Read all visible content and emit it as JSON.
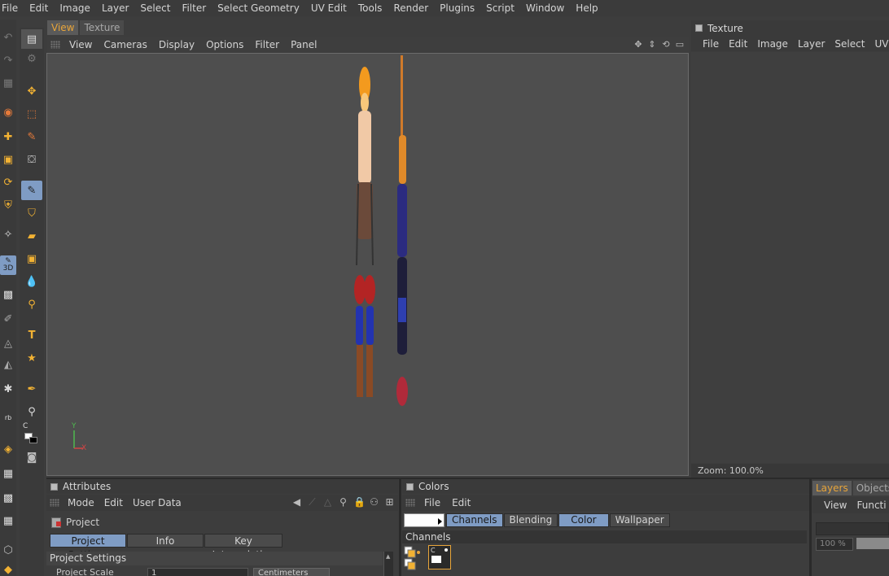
{
  "menubar": {
    "items": [
      "File",
      "Edit",
      "Image",
      "Layer",
      "Select",
      "Filter",
      "Select Geometry",
      "UV Edit",
      "Tools",
      "Render",
      "Plugins",
      "Script",
      "Window",
      "Help"
    ]
  },
  "tool_icons": {
    "outer": [
      "undo-icon",
      "redo-icon",
      "model-mode-icon",
      "texture-mode-icon",
      "move-icon",
      "scale-icon",
      "rotate-icon",
      "lock-axis-icon",
      "magic-brush-icon",
      "paint-3d-icon",
      "checker-icon",
      "brush-icon",
      "sketch-icon",
      "uv-icon",
      "cube-icon",
      "checkerboard-icon",
      "cube-small-icon",
      "checker-small-icon",
      "grid-icon",
      "box-icon"
    ],
    "inner_selected": "brush-tool",
    "paint_3d_badge": "3D",
    "rb_badge": "rb",
    "c_badge": "C"
  },
  "viewport": {
    "tabs": [
      "View",
      "Texture"
    ],
    "active_tab": "View",
    "menu": [
      "View",
      "Cameras",
      "Display",
      "Options",
      "Filter",
      "Panel"
    ],
    "axis_y": "Y",
    "axis_x": "X",
    "colors": {
      "background": "#4e4e4e",
      "axis_y": "#4fb84f",
      "axis_x": "#d24545"
    }
  },
  "texture_panel": {
    "title": "Texture",
    "menu": [
      "File",
      "Edit",
      "Image",
      "Layer",
      "Select",
      "UV E"
    ],
    "zoom_label": "Zoom: 100.0%"
  },
  "attributes": {
    "title": "Attributes",
    "menu": [
      "Mode",
      "Edit",
      "User Data"
    ],
    "object_name": "Project",
    "tabs": [
      "Project Settings",
      "Info",
      "Key Interpolation"
    ],
    "active_tab": "Project Settings",
    "section": "Project Settings",
    "row_label": "Project Scale",
    "row_value": "1",
    "row_unit": "Centimeters"
  },
  "colors_panel": {
    "title": "Colors",
    "menu": [
      "File",
      "Edit"
    ],
    "tabs": [
      "Channels",
      "Blending",
      "Color",
      "Wallpaper"
    ],
    "active_tabs": [
      "Channels",
      "Color"
    ],
    "channels_label": "Channels",
    "thumb_label": "C"
  },
  "layers_panel": {
    "tabs": [
      "Layers",
      "Objects"
    ],
    "active_tab": "Layers",
    "menu": [
      "View",
      "Functi"
    ],
    "zoom_value": "100 %"
  },
  "theme": {
    "accent": "#e8a53a",
    "selection": "#7f9cc4"
  }
}
